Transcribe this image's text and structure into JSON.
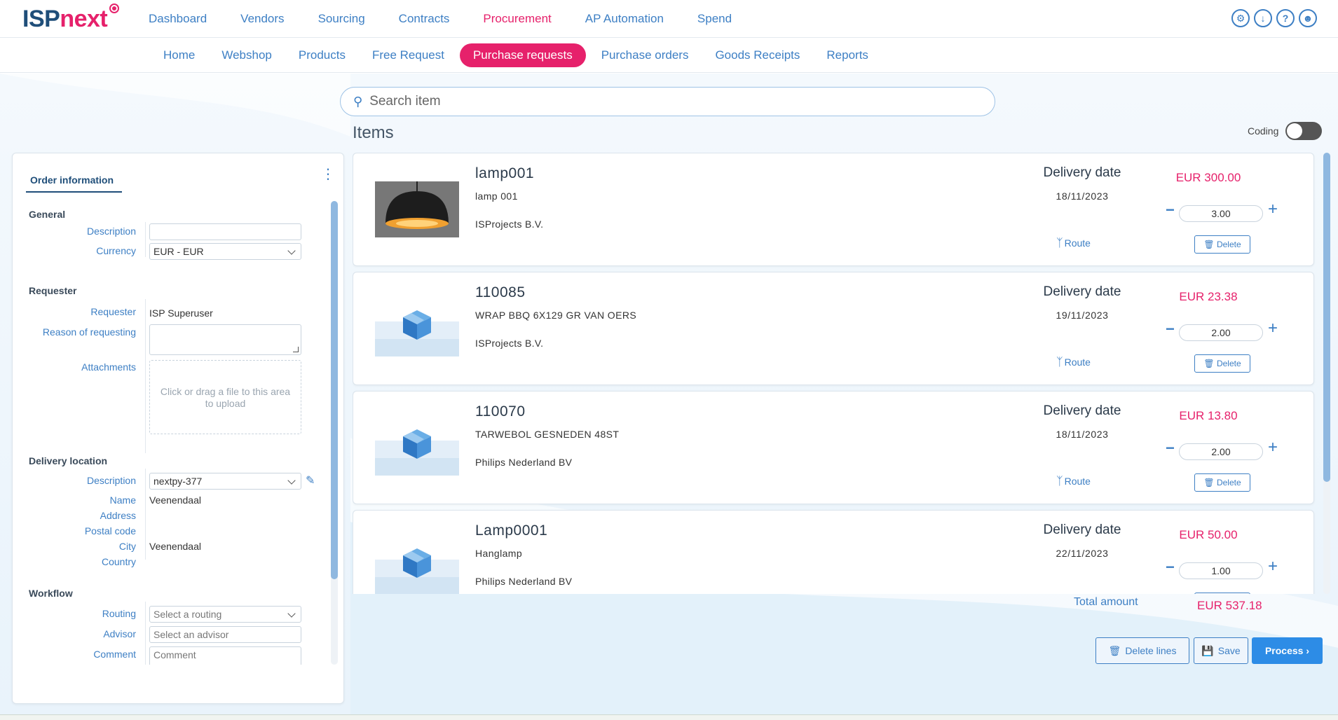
{
  "app": {
    "logo_isp": "ISP",
    "logo_next": "next"
  },
  "main_nav": [
    {
      "label": "Dashboard",
      "active": false
    },
    {
      "label": "Vendors",
      "active": false
    },
    {
      "label": "Sourcing",
      "active": false
    },
    {
      "label": "Contracts",
      "active": false
    },
    {
      "label": "Procurement",
      "active": true
    },
    {
      "label": "AP Automation",
      "active": false
    },
    {
      "label": "Spend",
      "active": false
    }
  ],
  "top_icons": [
    "gear-icon",
    "download-icon",
    "help-icon",
    "user-icon"
  ],
  "sub_nav": [
    {
      "label": "Home",
      "active": false
    },
    {
      "label": "Webshop",
      "active": false
    },
    {
      "label": "Products",
      "active": false
    },
    {
      "label": "Free Request",
      "active": false
    },
    {
      "label": "Purchase requests",
      "active": true
    },
    {
      "label": "Purchase orders",
      "active": false
    },
    {
      "label": "Goods Receipts",
      "active": false
    },
    {
      "label": "Reports",
      "active": false
    }
  ],
  "search": {
    "placeholder": "Search item",
    "value": ""
  },
  "items_title": "Items",
  "coding": {
    "label": "Coding",
    "on": false
  },
  "order_info": {
    "tab": "Order information",
    "general": {
      "heading": "General",
      "description_label": "Description",
      "description_value": "",
      "currency_label": "Currency",
      "currency_value": "EUR - EUR"
    },
    "requester": {
      "heading": "Requester",
      "requester_label": "Requester",
      "requester_value": "ISP Superuser",
      "reason_label": "Reason of requesting",
      "reason_value": "",
      "attachments_label": "Attachments",
      "dropzone_text": "Click or drag a file to this area to upload"
    },
    "delivery": {
      "heading": "Delivery location",
      "description_label": "Description",
      "description_value": "nextpy-377",
      "name_label": "Name",
      "name_value": "Veenendaal",
      "address_label": "Address",
      "address_value": "",
      "postal_label": "Postal code",
      "postal_value": "",
      "city_label": "City",
      "city_value": "Veenendaal",
      "country_label": "Country",
      "country_value": ""
    },
    "workflow": {
      "heading": "Workflow",
      "routing_label": "Routing",
      "routing_placeholder": "Select a routing",
      "advisor_label": "Advisor",
      "advisor_placeholder": "Select an advisor",
      "comment_label": "Comment",
      "comment_placeholder": "Comment"
    }
  },
  "item_labels": {
    "delivery_date": "Delivery date",
    "route": "Route",
    "delete": "Delete"
  },
  "items": [
    {
      "code": "lamp001",
      "description": "lamp 001",
      "vendor": "ISProjects B.V.",
      "delivery_date": "18/11/2023",
      "price": "EUR 300.00",
      "quantity": "3.00",
      "image": "lamp"
    },
    {
      "code": "110085",
      "description": "WRAP BBQ 6X129 GR VAN OERS",
      "vendor": "ISProjects B.V.",
      "delivery_date": "19/11/2023",
      "price": "EUR 23.38",
      "quantity": "2.00",
      "image": "box"
    },
    {
      "code": "110070",
      "description": "TARWEBOL GESNEDEN 48ST",
      "vendor": "Philips Nederland BV",
      "delivery_date": "18/11/2023",
      "price": "EUR 13.80",
      "quantity": "2.00",
      "image": "box"
    },
    {
      "code": "Lamp0001",
      "description": "Hanglamp",
      "vendor": "Philips Nederland BV",
      "delivery_date": "22/11/2023",
      "price": "EUR 50.00",
      "quantity": "1.00",
      "image": "box"
    }
  ],
  "total": {
    "label": "Total amount",
    "value": "EUR 537.18"
  },
  "actions": {
    "delete_lines": "Delete lines",
    "save": "Save",
    "process": "Process"
  }
}
